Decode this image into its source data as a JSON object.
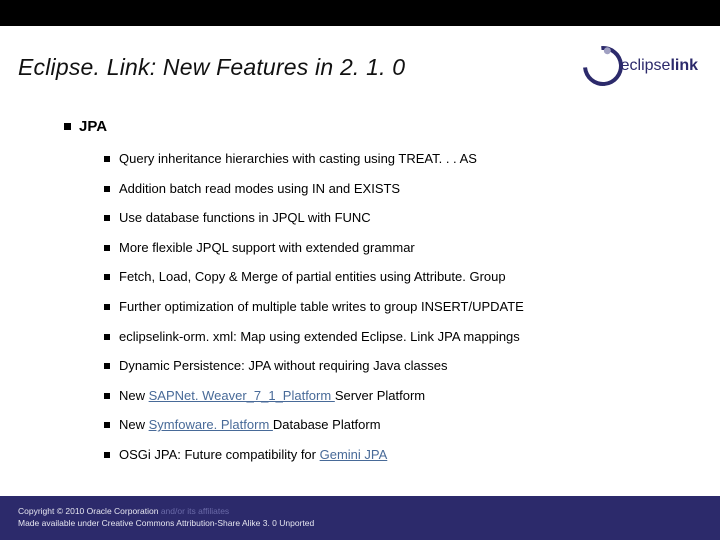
{
  "title": "Eclipse. Link: New Features in 2. 1. 0",
  "logo": {
    "word1": "eclipse",
    "word2": "link"
  },
  "section": {
    "heading": "JPA"
  },
  "items": [
    {
      "pre": "Query inheritance hierarchies with casting using TREAT. . . AS"
    },
    {
      "pre": "Addition batch read modes using IN and EXISTS"
    },
    {
      "pre": "Use database functions in JPQL with FUNC"
    },
    {
      "pre": "More flexible JPQL support with extended grammar"
    },
    {
      "pre": "Fetch, Load, Copy & Merge of partial entities using Attribute. Group"
    },
    {
      "pre": "Further optimization of multiple table writes to group INSERT/UPDATE"
    },
    {
      "pre": "eclipselink-orm. xml: Map using extended Eclipse. Link JPA mappings"
    },
    {
      "pre": "Dynamic Persistence: JPA without requiring Java classes"
    },
    {
      "pre": "New ",
      "link": "SAPNet. Weaver_7_1_Platform ",
      "post": "Server Platform"
    },
    {
      "pre": "New ",
      "link": "Symfoware. Platform ",
      "post": "Database Platform"
    },
    {
      "pre": "OSGi JPA: Future compatibility for ",
      "link": "Gemini JPA"
    }
  ],
  "footer": {
    "line1a": "Copyright © 2010 Oracle Corporation",
    "line1b": " and/or its affiliates",
    "line2": "Made available under Creative Commons Attribution-Share Alike 3. 0 Unported"
  }
}
